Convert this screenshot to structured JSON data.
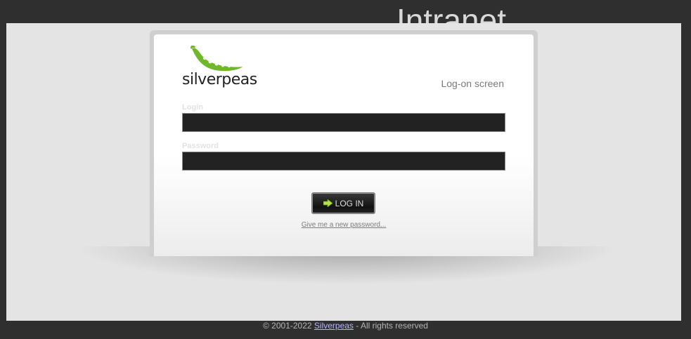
{
  "header": {
    "title": "Intranet"
  },
  "brand": {
    "logo_text": "silverpeas",
    "accent_color": "#6fb82a"
  },
  "login_box": {
    "screen_label": "Log-on screen",
    "login_label": "Login",
    "login_value": "",
    "password_label": "Password",
    "password_value": "",
    "button_label": "LOG IN",
    "button_icon": "arrow-right-icon",
    "forgot_link": "Give me a new password..."
  },
  "footer": {
    "prefix": "© 2001-2022 ",
    "link_text": "Silverpeas",
    "suffix": " - All rights reserved"
  }
}
